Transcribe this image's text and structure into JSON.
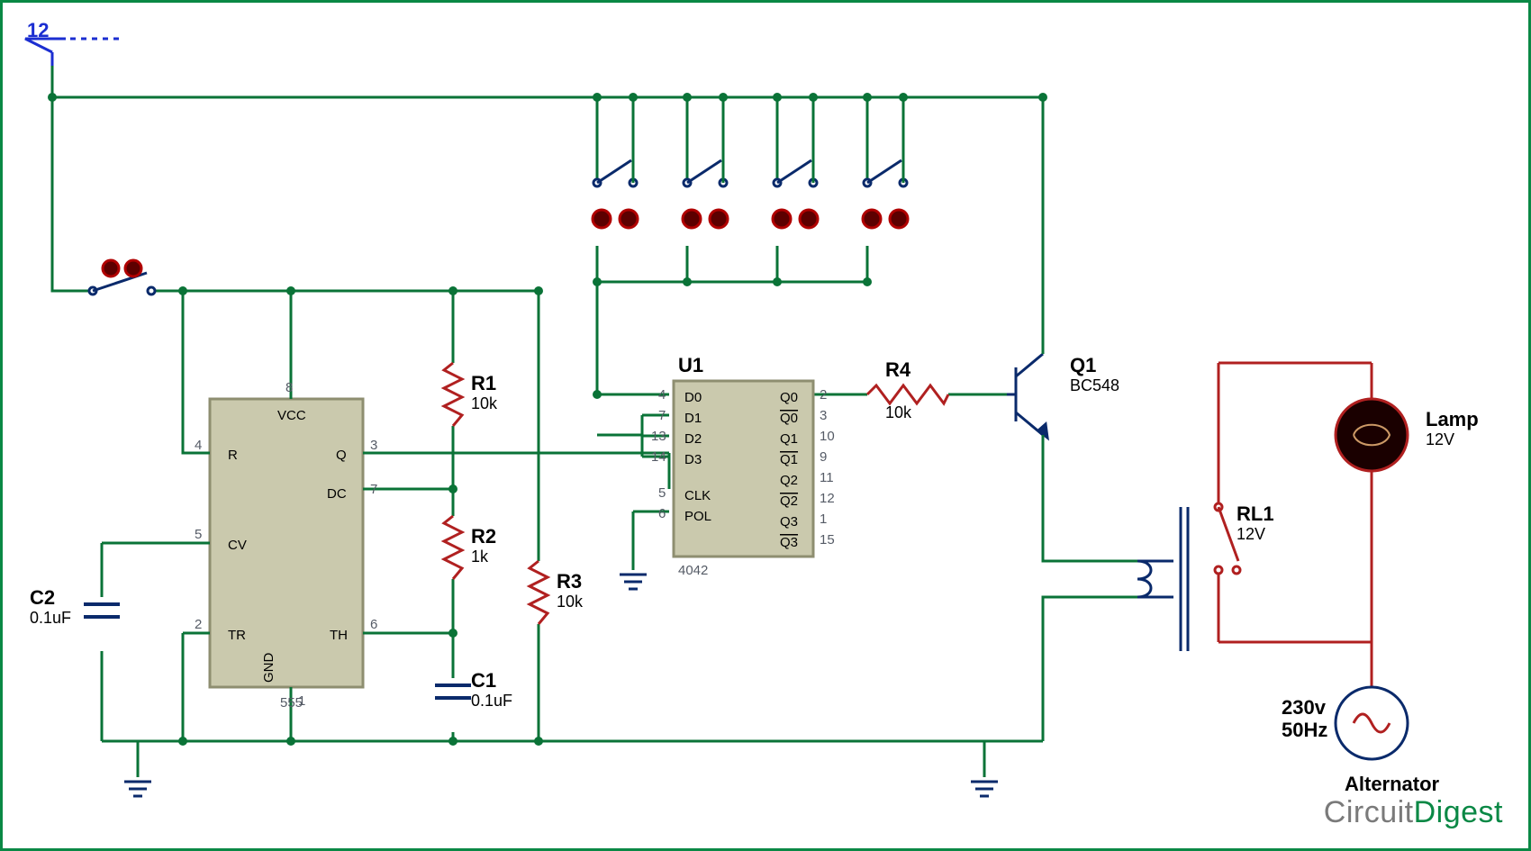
{
  "supply": {
    "label": "12"
  },
  "ic555": {
    "ref": "555",
    "pins": {
      "R": "R",
      "VCC": "VCC",
      "Q": "Q",
      "DC": "DC",
      "CV": "CV",
      "TR": "TR",
      "TH": "TH",
      "GND": "GND"
    },
    "nums": {
      "R": "4",
      "VCC": "8",
      "Q": "3",
      "DC": "7",
      "CV": "5",
      "TR": "2",
      "TH": "6",
      "GND": "1"
    }
  },
  "u1": {
    "ref": "U1",
    "part": "4042",
    "pins_left": [
      "D0",
      "D1",
      "D2",
      "D3",
      "",
      "CLK",
      "POL"
    ],
    "nums_left": [
      "4",
      "7",
      "13",
      "14",
      "",
      "5",
      "6"
    ],
    "pins_right": [
      "Q0",
      "Q0",
      "Q1",
      "Q1",
      "Q2",
      "Q2",
      "Q3",
      "Q3"
    ],
    "nums_right": [
      "2",
      "3",
      "10",
      "9",
      "11",
      "12",
      "1",
      "15"
    ]
  },
  "R1": {
    "ref": "R1",
    "val": "10k"
  },
  "R2": {
    "ref": "R2",
    "val": "1k"
  },
  "R3": {
    "ref": "R3",
    "val": "10k"
  },
  "R4": {
    "ref": "R4",
    "val": "10k"
  },
  "C1": {
    "ref": "C1",
    "val": "0.1uF"
  },
  "C2": {
    "ref": "C2",
    "val": "0.1uF"
  },
  "Q1": {
    "ref": "Q1",
    "val": "BC548"
  },
  "RL1": {
    "ref": "RL1",
    "val": "12V"
  },
  "lamp": {
    "ref": "Lamp",
    "val": "12V"
  },
  "ac": {
    "v": "230v",
    "f": "50Hz",
    "name": "Alternator"
  },
  "logo": {
    "a": "Circuit",
    "b": "Digest"
  }
}
